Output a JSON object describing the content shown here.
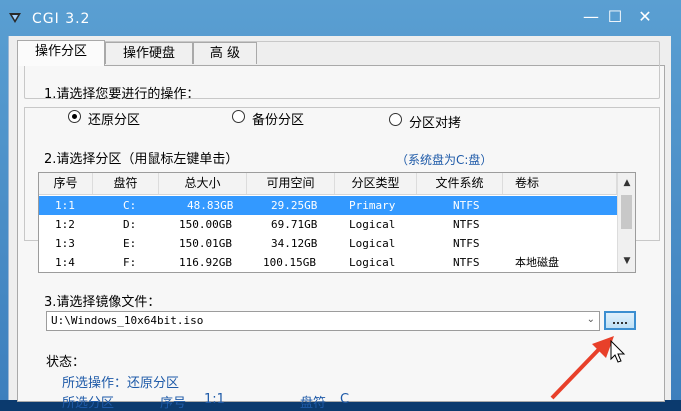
{
  "window": {
    "title": "CGI 3.2",
    "controls": {
      "minimize": "—",
      "maximize": "☐",
      "close": "✕"
    }
  },
  "tabs": [
    {
      "label": "操作分区",
      "active": true
    },
    {
      "label": "操作硬盘",
      "active": false
    },
    {
      "label": "高 级",
      "active": false
    }
  ],
  "step1": {
    "label": "1.请选择您要进行的操作：",
    "options": [
      {
        "label": "还原分区",
        "checked": true
      },
      {
        "label": "备份分区",
        "checked": false
      },
      {
        "label": "分区对拷",
        "checked": false
      }
    ]
  },
  "step2": {
    "label": "2.请选择分区（用鼠标左键单击）",
    "system_disk": "（系统盘为C:盘）"
  },
  "table": {
    "columns": [
      "序号",
      "盘符",
      "总大小",
      "可用空间",
      "分区类型",
      "文件系统",
      "卷标"
    ],
    "rows": [
      [
        "1:1",
        "C:",
        "48.83GB",
        "29.25GB",
        "Primary",
        "NTFS",
        ""
      ],
      [
        "1:2",
        "D:",
        "150.00GB",
        "69.71GB",
        "Logical",
        "NTFS",
        ""
      ],
      [
        "1:3",
        "E:",
        "150.01GB",
        "34.12GB",
        "Logical",
        "NTFS",
        ""
      ],
      [
        "1:4",
        "F:",
        "116.92GB",
        "100.15GB",
        "Logical",
        "NTFS",
        "本地磁盘"
      ]
    ],
    "selected_row": 0,
    "scroll_up": "▲",
    "scroll_down": "▼"
  },
  "step3": {
    "label": "3.请选择镜像文件：",
    "file_value": "U:\\Windows_10x64bit.iso",
    "dropdown_arrow": "⌄",
    "browse_icon": "ellipsis-icon"
  },
  "status": {
    "label": "状态：",
    "operation": "所选操作：还原分区",
    "partition_prefix": "所选分区",
    "seq_label": "序号",
    "seq_value": "1:1",
    "drive_label": "盘符",
    "drive_value": "C"
  },
  "colors": {
    "accent": "#3399ff",
    "title_bg": "#4a8fcb",
    "annotation_arrow": "#e8402a",
    "status_text": "#1e5aa8"
  }
}
